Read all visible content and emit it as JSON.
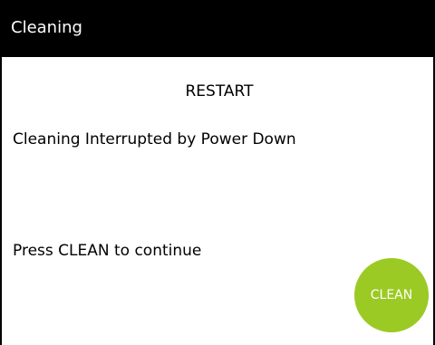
{
  "window": {
    "title": "Cleaning"
  },
  "main": {
    "heading": "RESTART",
    "message": "Cleaning Interrupted by Power Down",
    "instruction": "Press CLEAN to continue"
  },
  "actions": {
    "clean_label": "CLEAN",
    "clean_color": "#9bca24"
  },
  "theme": {
    "titlebar_bg": "#000000",
    "titlebar_fg": "#ffffff",
    "background": "#ffffff"
  }
}
